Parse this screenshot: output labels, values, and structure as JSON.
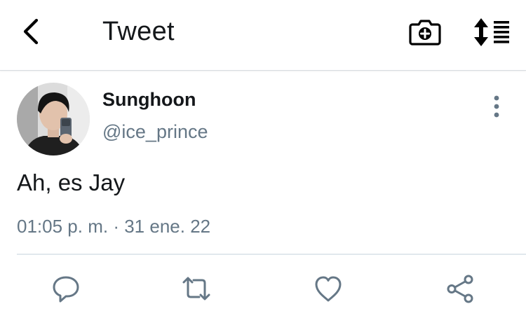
{
  "header": {
    "title": "Tweet",
    "back_icon": "chevron-left-icon",
    "camera_icon": "camera-plus-icon",
    "sort_icon": "sort-list-icon"
  },
  "tweet": {
    "author_name": "Sunghoon",
    "author_handle": "@ice_prince",
    "text": "Ah, es Jay",
    "time": "01:05 p. m.",
    "separator": "·",
    "date": "31 ene. 22"
  },
  "actions": [
    {
      "icon": "reply-icon"
    },
    {
      "icon": "retweet-icon"
    },
    {
      "icon": "heart-icon"
    },
    {
      "icon": "share-icon"
    }
  ],
  "colors": {
    "text_primary": "#14171a",
    "text_secondary": "#657786",
    "divider": "#e1e8ed",
    "icon": "#657786",
    "header_icon": "#000000"
  }
}
